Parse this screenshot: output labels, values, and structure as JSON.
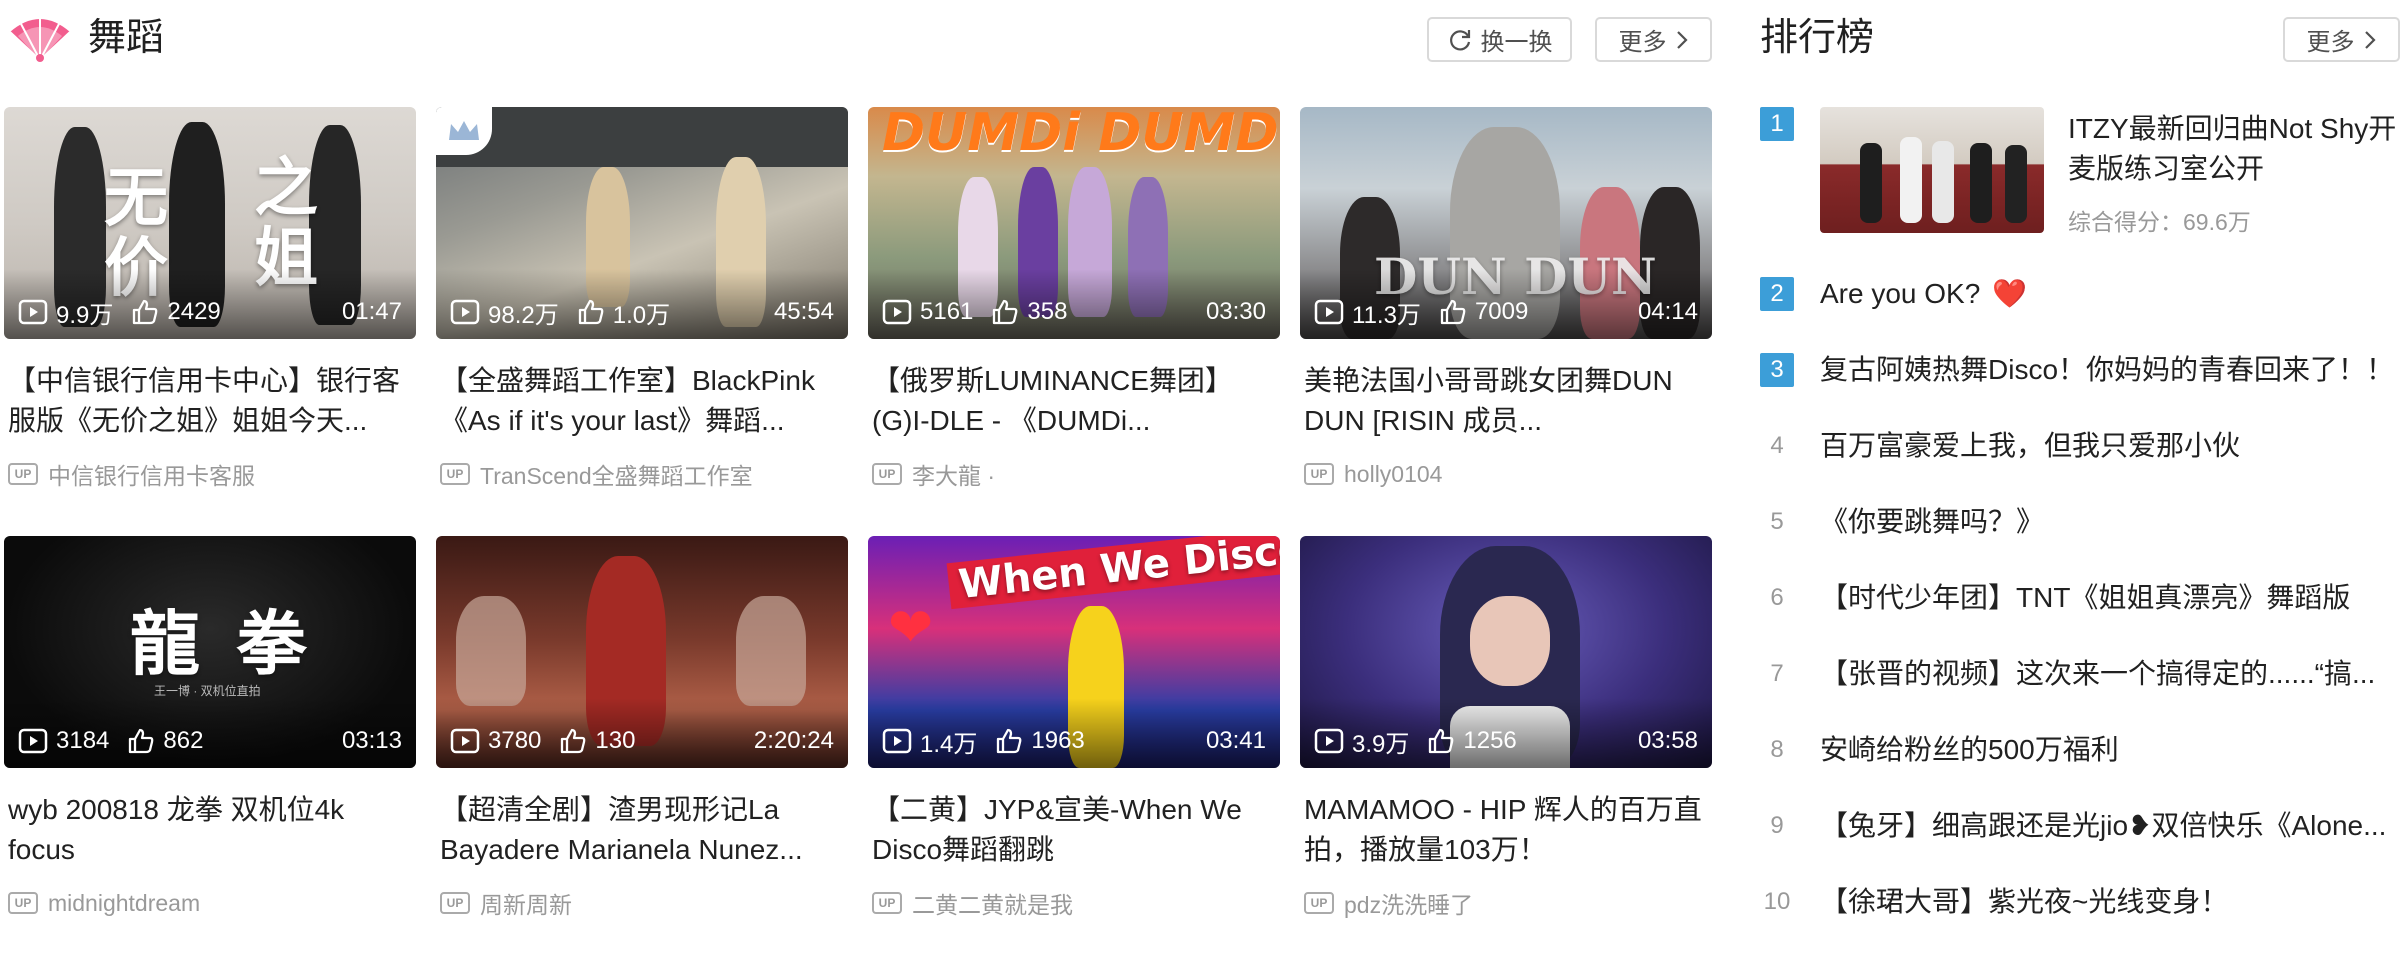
{
  "section": {
    "title": "舞蹈",
    "refresh_label": "换一换",
    "more_label": "更多"
  },
  "videos": [
    {
      "title": "【中信银行信用卡中心】银行客服版《无价之姐》姐姐今天...",
      "plays": "9.9万",
      "likes": "2429",
      "duration": "01:47",
      "uploader": "中信银行信用卡客服",
      "overlay": [
        "无",
        "价",
        "之",
        "姐"
      ]
    },
    {
      "title": "【全盛舞蹈工作室】BlackPink《As if it's your last》舞蹈...",
      "plays": "98.2万",
      "likes": "1.0万",
      "duration": "45:54",
      "uploader": "TranScend全盛舞蹈工作室"
    },
    {
      "title": "【俄罗斯LUMINANCE舞团】(G)I-DLE - 《DUMDi...",
      "plays": "5161",
      "likes": "358",
      "duration": "03:30",
      "uploader": "李大龍 ·",
      "overlay": "DUMDi DUMDi"
    },
    {
      "title": "美艳法国小哥哥跳女团舞DUN DUN [RISIN 成员...",
      "plays": "11.3万",
      "likes": "7009",
      "duration": "04:14",
      "uploader": "holly0104",
      "overlay": "DUN DUN"
    },
    {
      "title": "wyb 200818 龙拳 双机位4k focus",
      "plays": "3184",
      "likes": "862",
      "duration": "03:13",
      "uploader": "midnightdream",
      "overlay": "龍 拳",
      "overlay_sub": "王一博 · 双机位直拍"
    },
    {
      "title": "【超清全剧】渣男现形记La Bayadere Marianela Nunez...",
      "plays": "3780",
      "likes": "130",
      "duration": "2:20:24",
      "uploader": "周新周新"
    },
    {
      "title": "【二黄】JYP&宣美-When We Disco舞蹈翻跳",
      "plays": "1.4万",
      "likes": "1963",
      "duration": "03:41",
      "uploader": "二黄二黄就是我",
      "overlay": "When We Disco"
    },
    {
      "title": "MAMAMOO - HIP 辉人的百万直拍，播放量103万！",
      "plays": "3.9万",
      "likes": "1256",
      "duration": "03:58",
      "uploader": "pdz洗洗睡了"
    }
  ],
  "up_badge": "UP",
  "ranking": {
    "title": "排行榜",
    "more_label": "更多",
    "top": {
      "rank": "1",
      "title": "ITZY最新回归曲Not Shy开麦版练习室公开",
      "score": "综合得分：69.6万"
    },
    "items": [
      {
        "rank": "2",
        "title": "Are you OK?",
        "emoji": "❤️"
      },
      {
        "rank": "3",
        "title": "复古阿姨热舞Disco！你妈妈的青春回来了！！"
      },
      {
        "rank": "4",
        "title": "百万富豪爱上我，但我只爱那小伙"
      },
      {
        "rank": "5",
        "title": "《你要跳舞吗？》"
      },
      {
        "rank": "6",
        "title": "【时代少年团】TNT《姐姐真漂亮》舞蹈版"
      },
      {
        "rank": "7",
        "title": "【张晋的视频】这次来一个搞得定的......“搞..."
      },
      {
        "rank": "8",
        "title": "安崎给粉丝的500万福利"
      },
      {
        "rank": "9",
        "title": "【兔牙】细高跟还是光jio❥双倍快乐《Alone..."
      },
      {
        "rank": "10",
        "title": "【徐珺大哥】紫光夜~光线变身！"
      }
    ]
  },
  "colors": {
    "accent_pink": "#f25d8e",
    "rank_badge": "#3c9ed8",
    "text_main": "#212121",
    "text_muted": "#999999"
  },
  "icons": {
    "section": "fan-icon",
    "refresh": "refresh-icon",
    "more": "chevron-right-icon",
    "plays": "play-count-icon",
    "likes": "thumbs-up-icon",
    "vip": "crown-icon"
  }
}
